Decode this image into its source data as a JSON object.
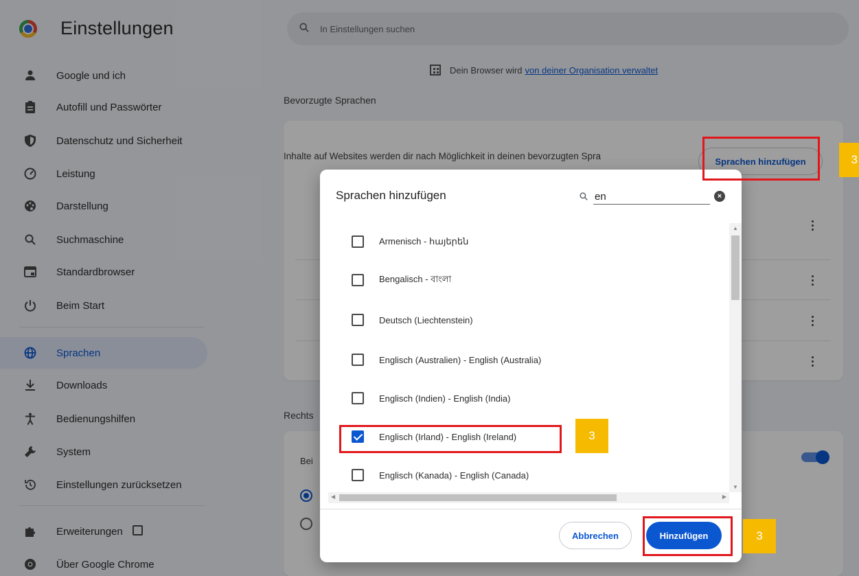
{
  "sidebar": {
    "app_title": "Einstellungen",
    "items": [
      {
        "label": "Google und ich",
        "icon": "person-icon"
      },
      {
        "label": "Autofill und Passwörter",
        "icon": "clipboard-icon"
      },
      {
        "label": "Datenschutz und Sicherheit",
        "icon": "shield-icon"
      },
      {
        "label": "Leistung",
        "icon": "speedometer-icon"
      },
      {
        "label": "Darstellung",
        "icon": "palette-icon"
      },
      {
        "label": "Suchmaschine",
        "icon": "search-icon"
      },
      {
        "label": "Standardbrowser",
        "icon": "browser-window-icon"
      },
      {
        "label": "Beim Start",
        "icon": "power-icon"
      },
      {
        "label": "Sprachen",
        "icon": "globe-icon",
        "active": true
      },
      {
        "label": "Downloads",
        "icon": "download-icon"
      },
      {
        "label": "Bedienungshilfen",
        "icon": "accessibility-icon"
      },
      {
        "label": "System",
        "icon": "wrench-icon"
      },
      {
        "label": "Einstellungen zurücksetzen",
        "icon": "history-icon"
      },
      {
        "label": "Erweiterungen",
        "icon": "puzzle-icon"
      },
      {
        "label": "Über Google Chrome",
        "icon": "chrome-icon"
      }
    ]
  },
  "search": {
    "placeholder": "In Einstellungen suchen"
  },
  "managed_notice": {
    "text": "Dein Browser wird",
    "link": "von deiner Organisation verwaltet"
  },
  "languages_section": {
    "title": "Bevorzugte Sprachen",
    "description": "Inhalte auf Websites werden dir nach Möglichkeit in deinen bevorzugten Spra",
    "add_button": "Sprachen hinzufügen"
  },
  "spellcheck_section": {
    "title_visible": "Rechts",
    "row_text": "Bei"
  },
  "dialog": {
    "title": "Sprachen hinzufügen",
    "search_value": "en",
    "languages": [
      {
        "label": "Armenisch - հայերեն",
        "checked": false
      },
      {
        "label": "Bengalisch - বাংলা",
        "checked": false
      },
      {
        "label": "Deutsch (Liechtenstein)",
        "checked": false
      },
      {
        "label": "Englisch (Australien) - English (Australia)",
        "checked": false
      },
      {
        "label": "Englisch (Indien) - English (India)",
        "checked": false
      },
      {
        "label": "Englisch (Irland) - English (Ireland)",
        "checked": true
      },
      {
        "label": "Englisch (Kanada) - English (Canada)",
        "checked": false
      }
    ],
    "cancel_label": "Abbrechen",
    "add_label": "Hinzufügen"
  },
  "annotations": {
    "step_number": "3",
    "highlight_color": "#e1161b",
    "badge_color": "#f6bb00"
  },
  "colors": {
    "accent": "#0b57d0",
    "background": "#f1f3f8",
    "active_nav": "#dfe6f7"
  }
}
